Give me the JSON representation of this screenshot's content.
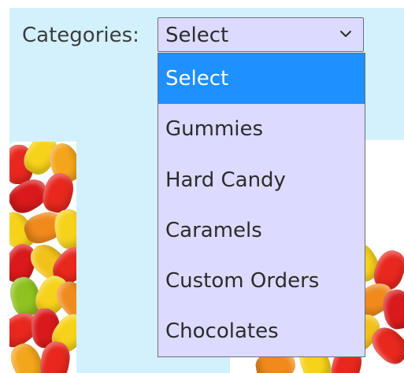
{
  "form": {
    "label": "Categories:"
  },
  "select": {
    "selected_value": "Select",
    "options": [
      {
        "label": "Select",
        "highlighted": true
      },
      {
        "label": "Gummies",
        "highlighted": false
      },
      {
        "label": "Hard Candy",
        "highlighted": false
      },
      {
        "label": "Caramels",
        "highlighted": false
      },
      {
        "label": "Custom Orders",
        "highlighted": false
      },
      {
        "label": "Chocolates",
        "highlighted": false
      }
    ]
  },
  "icons": {
    "dropdown_arrow": "chevron-down-icon"
  },
  "colors": {
    "page_background": "#d3f1fd",
    "select_background": "#dcdaff",
    "highlight": "#1e90ff",
    "text": "#2c2c2c"
  }
}
